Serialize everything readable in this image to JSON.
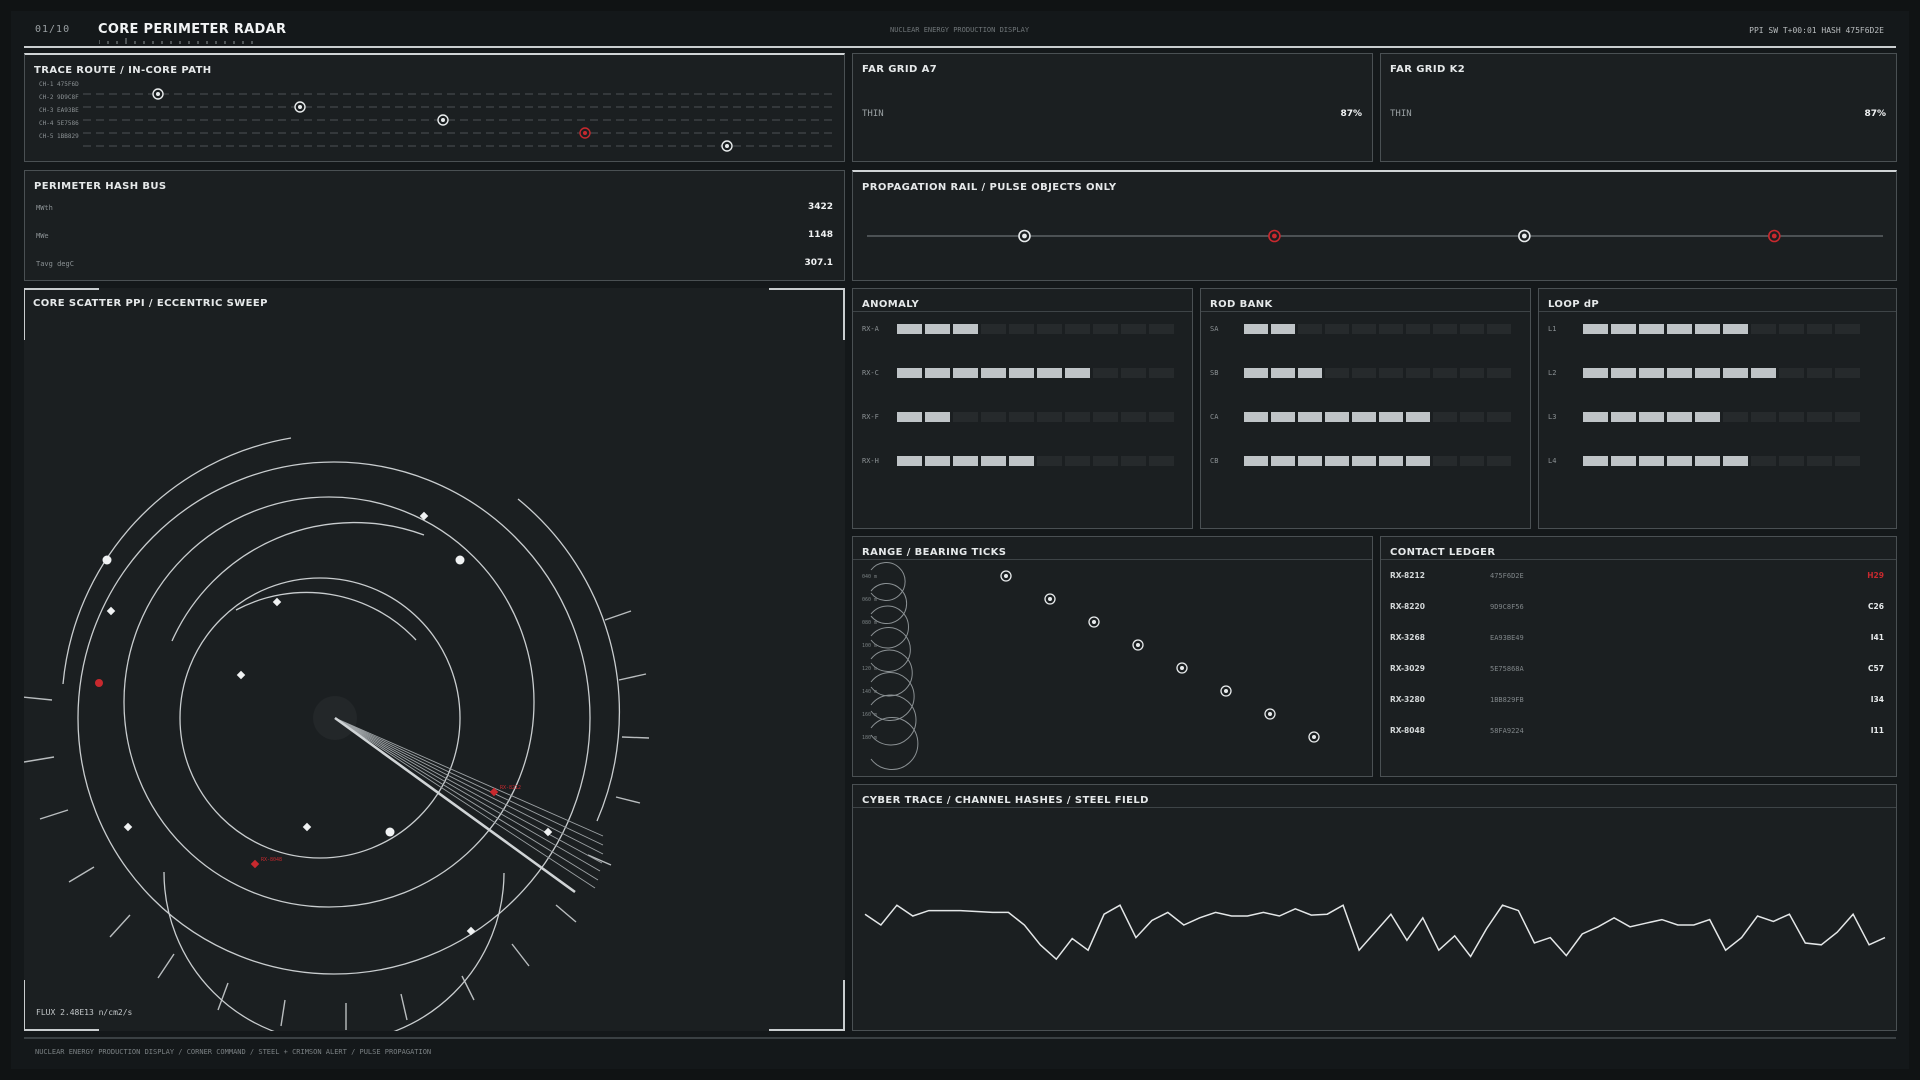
{
  "header": {
    "page_index": "01/10",
    "title": "CORE PERIMETER RADAR",
    "center_label": "NUCLEAR ENERGY PRODUCTION DISPLAY",
    "status": "PPI SW T+00:01  HASH 475F6D2E"
  },
  "trace_route": {
    "title": "TRACE ROUTE  /  IN-CORE PATH",
    "channels": [
      "CH-1 475F6D",
      "CH-2 9D9C8F",
      "CH-3 EA93BE",
      "CH-4 5E7586",
      "CH-5 1BB829"
    ],
    "alert_channel": 4
  },
  "far_grid_a": {
    "title": "FAR GRID  A7",
    "label": "THIN",
    "value": "87%"
  },
  "far_grid_b": {
    "title": "FAR GRID  K2",
    "label": "THIN",
    "value": "87%"
  },
  "hash_bus": {
    "title": "PERIMETER HASH BUS",
    "rows": [
      {
        "label": "MWth",
        "value": "3422"
      },
      {
        "label": "MWe",
        "value": "1148"
      },
      {
        "label": "Tavg degC",
        "value": "307.1"
      }
    ]
  },
  "propagation": {
    "title": "PROPAGATION RAIL  /  PULSE OBJECTS ONLY",
    "pulses": [
      {
        "position": 0.155,
        "alert": false
      },
      {
        "position": 0.401,
        "alert": true
      },
      {
        "position": 0.647,
        "alert": false
      },
      {
        "position": 0.893,
        "alert": true
      }
    ]
  },
  "radar": {
    "title": "CORE SCATTER PPI  /  ECCENTRIC SWEEP",
    "flux": "FLUX 2.48E13 n/cm2/s",
    "targets": [
      {
        "label": "RX-8212",
        "alert": true
      },
      {
        "label": "RX-8048",
        "alert": true
      }
    ]
  },
  "anomaly": {
    "title": "ANOMALY",
    "rows": [
      {
        "label": "RX-A",
        "level": 3
      },
      {
        "label": "RX-C",
        "level": 7
      },
      {
        "label": "RX-F",
        "level": 2
      },
      {
        "label": "RX-H",
        "level": 5
      }
    ]
  },
  "rod_bank": {
    "title": "ROD BANK",
    "rows": [
      {
        "label": "SA",
        "level": 2
      },
      {
        "label": "SB",
        "level": 3
      },
      {
        "label": "CA",
        "level": 7
      },
      {
        "label": "CB",
        "level": 7
      }
    ]
  },
  "loop_dp": {
    "title": "LOOP dP",
    "rows": [
      {
        "label": "L1",
        "level": 6
      },
      {
        "label": "L2",
        "level": 7
      },
      {
        "label": "L3",
        "level": 5
      },
      {
        "label": "L4",
        "level": 6
      }
    ]
  },
  "bar_segments_total": 10,
  "range_bearing": {
    "title": "RANGE / BEARING TICKS",
    "ranges": [
      "040 m",
      "060 m",
      "080 m",
      "100 m",
      "120 m",
      "140 m",
      "160 m",
      "180 m"
    ]
  },
  "ledger": {
    "title": "CONTACT LEDGER",
    "rows": [
      {
        "id": "RX-8212",
        "hash": "475F6D2E",
        "code": "H29",
        "alert": true
      },
      {
        "id": "RX-8220",
        "hash": "9D9C8F56",
        "code": "C26",
        "alert": false
      },
      {
        "id": "RX-3268",
        "hash": "EA93BE49",
        "code": "I41",
        "alert": false
      },
      {
        "id": "RX-3029",
        "hash": "5E75868A",
        "code": "C57",
        "alert": false
      },
      {
        "id": "RX-3280",
        "hash": "1BB829FB",
        "code": "I34",
        "alert": false
      },
      {
        "id": "RX-8048",
        "hash": "58FA9224",
        "code": "I11",
        "alert": false
      }
    ]
  },
  "cyber_trace": {
    "title": "CYBER TRACE  /  CHANNEL HASHES  /  STEEL FIELD",
    "values": [
      0.62,
      0.5,
      0.72,
      0.6,
      0.66,
      0.66,
      0.66,
      0.65,
      0.64,
      0.64,
      0.5,
      0.28,
      0.12,
      0.35,
      0.22,
      0.62,
      0.72,
      0.36,
      0.55,
      0.64,
      0.5,
      0.58,
      0.64,
      0.6,
      0.6,
      0.64,
      0.6,
      0.68,
      0.61,
      0.62,
      0.72,
      0.22,
      0.42,
      0.62,
      0.33,
      0.58,
      0.22,
      0.38,
      0.15,
      0.46,
      0.72,
      0.66,
      0.3,
      0.36,
      0.16,
      0.4,
      0.48,
      0.58,
      0.48,
      0.52,
      0.56,
      0.5,
      0.5,
      0.56,
      0.22,
      0.36,
      0.6,
      0.54,
      0.62,
      0.3,
      0.28,
      0.42,
      0.62,
      0.28,
      0.36
    ]
  },
  "colors": {
    "alert": "#c8292e",
    "steel": "#c9cdcf",
    "background": "#14181a"
  },
  "footer": {
    "text": "NUCLEAR ENERGY PRODUCTION DISPLAY  /  CORNER COMMAND  /  STEEL + CRIMSON ALERT  /  PULSE PROPAGATION"
  }
}
